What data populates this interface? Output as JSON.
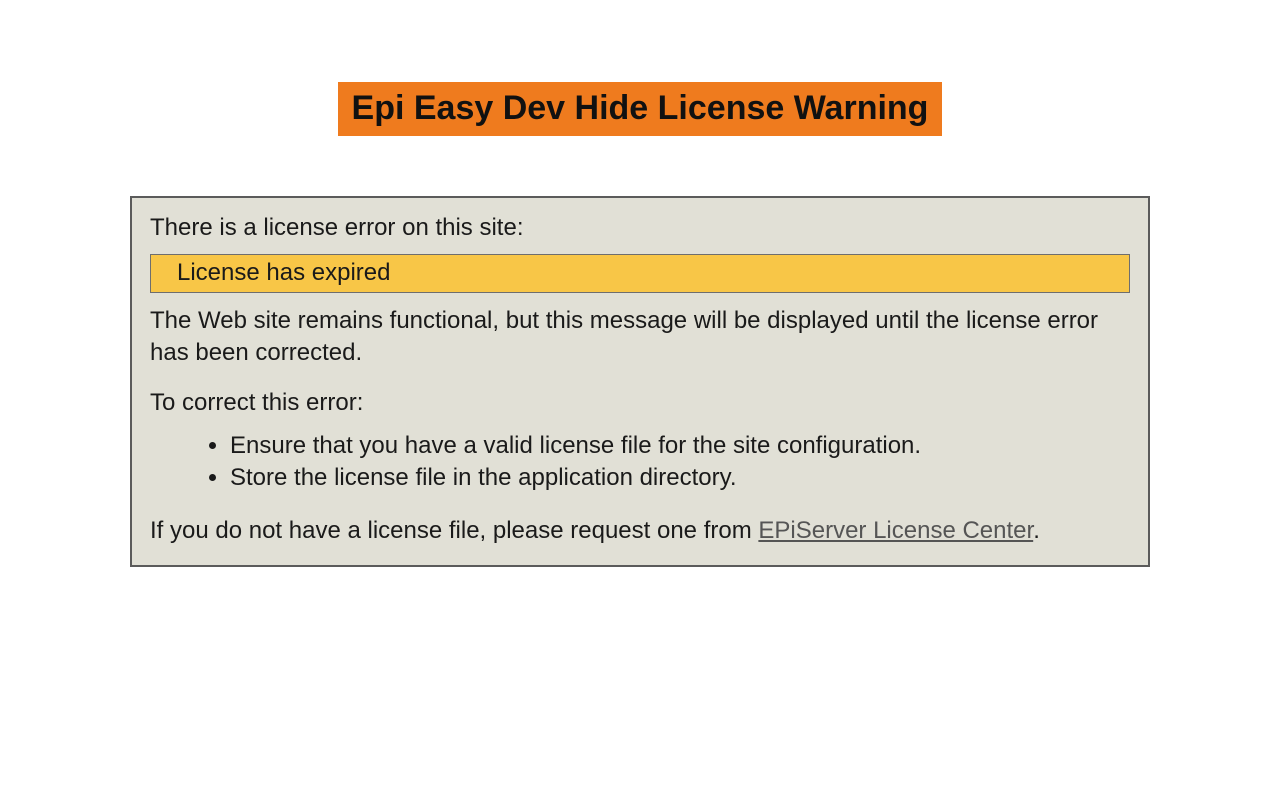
{
  "header": {
    "title": "Epi Easy Dev Hide License Warning"
  },
  "error": {
    "intro": "There is a license error on this site:",
    "highlight": "License has expired",
    "explanation": "The Web site remains functional, but this message will be displayed until the license error has been corrected.",
    "correct_label": "To correct this error:",
    "steps": [
      "Ensure that you have a valid license file for the site configuration.",
      "Store the license file in the application directory."
    ],
    "footer_prefix": "If you do not have a license file, please request one from ",
    "footer_link_text": "EPiServer License Center",
    "footer_suffix": "."
  }
}
